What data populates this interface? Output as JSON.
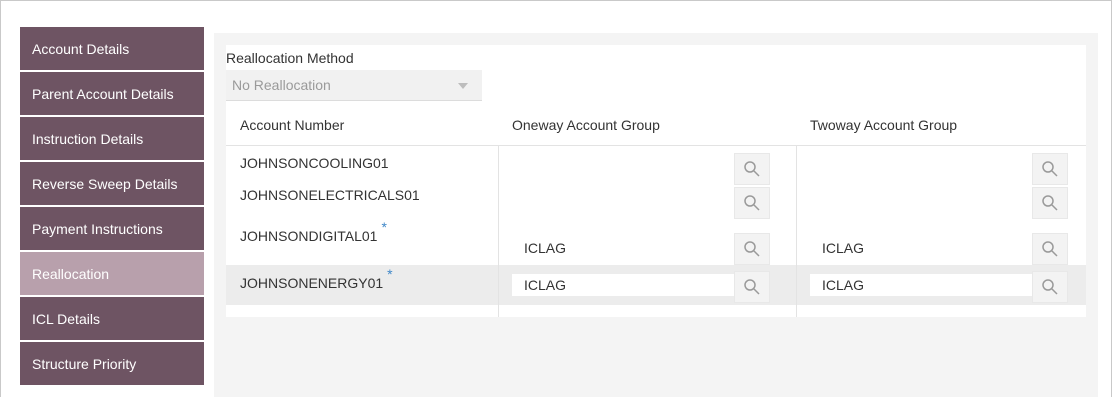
{
  "sidebar": {
    "items": [
      {
        "label": "Account Details"
      },
      {
        "label": "Parent Account Details"
      },
      {
        "label": "Instruction Details"
      },
      {
        "label": "Reverse Sweep Details"
      },
      {
        "label": "Payment Instructions"
      },
      {
        "label": "Reallocation",
        "active": true
      },
      {
        "label": "ICL Details"
      },
      {
        "label": "Structure Priority"
      }
    ]
  },
  "reallocation": {
    "method_label": "Reallocation Method",
    "method_value": "No Reallocation"
  },
  "table": {
    "headers": {
      "account_number": "Account Number",
      "oneway": "Oneway Account Group",
      "twoway": "Twoway Account Group"
    },
    "rows": [
      {
        "account": "JOHNSONCOOLING01",
        "required": "",
        "oneway": "",
        "twoway": ""
      },
      {
        "account": "JOHNSONELECTRICALS01",
        "required": "",
        "oneway": "",
        "twoway": ""
      },
      {
        "account": "JOHNSONDIGITAL01",
        "required": "*",
        "oneway": "ICLAG",
        "twoway": "ICLAG"
      },
      {
        "account": "JOHNSONENERGY01",
        "required": "*",
        "oneway": "ICLAG",
        "twoway": "ICLAG"
      }
    ]
  },
  "colors": {
    "sidebar_bg": "#6e5463",
    "sidebar_active_bg": "#b8a0ac",
    "required_star": "#3f87c8"
  }
}
